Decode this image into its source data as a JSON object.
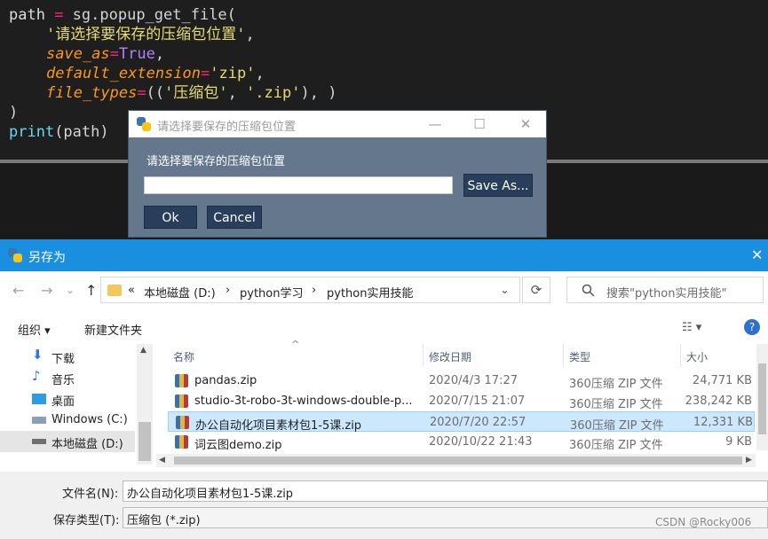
{
  "code": {
    "line1": {
      "var": "path",
      "op": " = ",
      "call": "sg.popup_get_file("
    },
    "line2": {
      "str": "'请选择要保存的压缩包位置'",
      "tail": ","
    },
    "line3": {
      "param": "save_as",
      "eq": "=",
      "val": "True",
      "tail": ","
    },
    "line4": {
      "param": "default_extension",
      "eq": "=",
      "val": "'zip'",
      "tail": ","
    },
    "line5": {
      "param": "file_types",
      "eq": "=",
      "open": "((",
      "s1": "'压缩包'",
      "comma": ", ",
      "s2": "'.zip'",
      "close": "), )"
    },
    "line6": {
      "text": ")"
    },
    "line7": {
      "fn": "print",
      "args": "(path)"
    }
  },
  "popup": {
    "title": "请选择要保存的压缩包位置",
    "label": "请选择要保存的压缩包位置",
    "input_value": "",
    "save_as_label": "Save As...",
    "ok_label": "Ok",
    "cancel_label": "Cancel",
    "minimize": "—",
    "maximize": "☐",
    "close": "✕"
  },
  "save_dialog": {
    "title": "另存为",
    "close": "✕",
    "back": "←",
    "forward": "→",
    "dropdown": "⌄",
    "up": "↑",
    "address": {
      "prefix": "«",
      "crumbs": [
        "本地磁盘 (D:)",
        "python学习",
        "python实用技能"
      ],
      "sep": "›",
      "dropdown": "⌄"
    },
    "refresh": "⟳",
    "search_placeholder": "搜索\"python实用技能\"",
    "toolbar": {
      "organize": "组织 ▾",
      "new_folder": "新建文件夹",
      "view": "☷ ▾",
      "help": "?"
    },
    "nav_items": [
      {
        "label": "下载",
        "icon": "download-icon"
      },
      {
        "label": "音乐",
        "icon": "music-icon"
      },
      {
        "label": "桌面",
        "icon": "desktop-icon"
      },
      {
        "label": "Windows (C:)",
        "icon": "drive-icon"
      },
      {
        "label": "本地磁盘 (D:)",
        "icon": "drive-icon"
      }
    ],
    "columns": {
      "name": "名称",
      "date": "修改日期",
      "type": "类型",
      "size": "大小",
      "sort_indicator": "^"
    },
    "files": [
      {
        "name": "pandas.zip",
        "date": "2020/4/3 17:27",
        "type": "360压缩 ZIP 文件",
        "size": "24,771 KB"
      },
      {
        "name": "studio-3t-robo-3t-windows-double-p...",
        "date": "2020/7/15 21:07",
        "type": "360压缩 ZIP 文件",
        "size": "238,242 KB"
      },
      {
        "name": "办公自动化项目素材包1-5课.zip",
        "date": "2020/7/20 22:57",
        "type": "360压缩 ZIP 文件",
        "size": "12,331 KB"
      },
      {
        "name": "词云图demo.zip",
        "date": "2020/10/22 21:43",
        "type": "360压缩 ZIP 文件",
        "size": "9 KB"
      }
    ],
    "filename_label": "文件名(N):",
    "filename_value": "办公自动化项目素材包1-5课.zip",
    "filetype_label": "保存类型(T):",
    "filetype_value": "压缩包 (*.zip)",
    "scroll_up": "▲",
    "scroll_down": "▼",
    "scroll_left": "◀",
    "scroll_right": "▶"
  },
  "watermark": "CSDN @Rocky006",
  "colors": {
    "accent": "#1a8fe0",
    "popup_bg": "#64778d",
    "popup_button": "#283e5a",
    "selection": "#cce8ff"
  }
}
